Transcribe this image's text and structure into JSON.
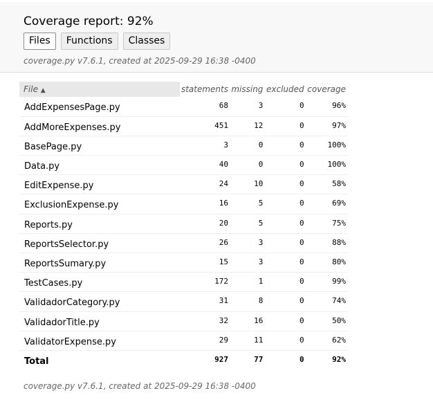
{
  "header": {
    "title": "Coverage report: 92%",
    "tabs": [
      {
        "label": "Files",
        "current": true
      },
      {
        "label": "Functions",
        "current": false
      },
      {
        "label": "Classes",
        "current": false
      }
    ],
    "meta": "coverage.py v7.6.1, created at 2025-09-29 16:38 -0400"
  },
  "table": {
    "columns": {
      "file": "File",
      "statements": "statements",
      "missing": "missing",
      "excluded": "excluded",
      "coverage": "coverage"
    },
    "sort_icon": "sort-up-icon",
    "rows": [
      {
        "file": "AddExpensesPage.py",
        "statements": "68",
        "missing": "3",
        "excluded": "0",
        "coverage": "96%"
      },
      {
        "file": "AddMoreExpenses.py",
        "statements": "451",
        "missing": "12",
        "excluded": "0",
        "coverage": "97%"
      },
      {
        "file": "BasePage.py",
        "statements": "3",
        "missing": "0",
        "excluded": "0",
        "coverage": "100%"
      },
      {
        "file": "Data.py",
        "statements": "40",
        "missing": "0",
        "excluded": "0",
        "coverage": "100%"
      },
      {
        "file": "EditExpense.py",
        "statements": "24",
        "missing": "10",
        "excluded": "0",
        "coverage": "58%"
      },
      {
        "file": "ExclusionExpense.py",
        "statements": "16",
        "missing": "5",
        "excluded": "0",
        "coverage": "69%"
      },
      {
        "file": "Reports.py",
        "statements": "20",
        "missing": "5",
        "excluded": "0",
        "coverage": "75%"
      },
      {
        "file": "ReportsSelector.py",
        "statements": "26",
        "missing": "3",
        "excluded": "0",
        "coverage": "88%"
      },
      {
        "file": "ReportsSumary.py",
        "statements": "15",
        "missing": "3",
        "excluded": "0",
        "coverage": "80%"
      },
      {
        "file": "TestCases.py",
        "statements": "172",
        "missing": "1",
        "excluded": "0",
        "coverage": "99%"
      },
      {
        "file": "ValidadorCategory.py",
        "statements": "31",
        "missing": "8",
        "excluded": "0",
        "coverage": "74%"
      },
      {
        "file": "ValidadorTitle.py",
        "statements": "32",
        "missing": "16",
        "excluded": "0",
        "coverage": "50%"
      },
      {
        "file": "ValidatorExpense.py",
        "statements": "29",
        "missing": "11",
        "excluded": "0",
        "coverage": "62%"
      }
    ],
    "total": {
      "file": "Total",
      "statements": "927",
      "missing": "77",
      "excluded": "0",
      "coverage": "92%"
    }
  },
  "footer": {
    "meta": "coverage.py v7.6.1, created at 2025-09-29 16:38 -0400"
  }
}
